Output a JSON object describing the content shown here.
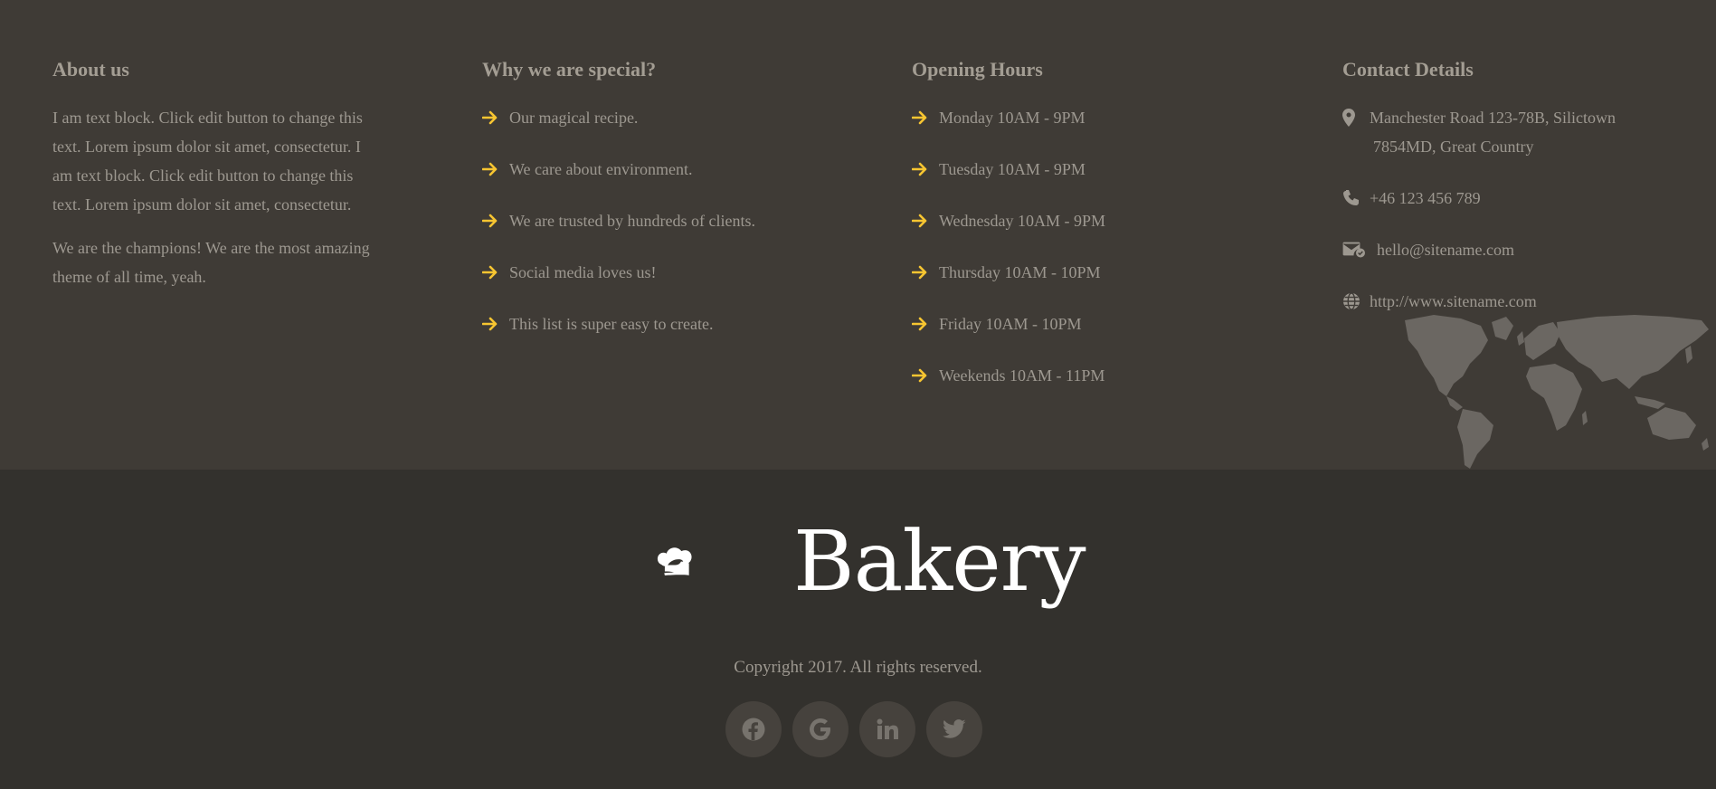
{
  "colors": {
    "accent": "#f7c531",
    "top_bg": "#3f3b36",
    "bottom_bg": "#33312d",
    "text": "#9d9890"
  },
  "about": {
    "title": "About us",
    "paragraph1": "I am text block. Click edit button to change this text. Lorem ipsum dolor sit amet, consectetur. I am text block. Click edit button to change this text. Lorem ipsum dolor sit amet, consectetur.",
    "paragraph2": "We are the champions! We are the most amazing theme of all time, yeah."
  },
  "special": {
    "title": "Why we are special?",
    "items": [
      "Our magical recipe.",
      "We care about environment.",
      "We are trusted by hundreds of clients.",
      "Social media loves us!",
      "This list is super easy to create."
    ]
  },
  "hours": {
    "title": "Opening Hours",
    "items": [
      "Monday 10AM - 9PM",
      "Tuesday 10AM - 9PM",
      "Wednesday 10AM - 9PM",
      "Thursday 10AM - 10PM",
      "Friday 10AM - 10PM",
      "Weekends 10AM - 11PM"
    ]
  },
  "contact": {
    "title": "Contact Details",
    "address_line1": "Manchester Road 123-78B, Silictown",
    "address_line2": "7854MD, Great Country",
    "phone": "+46 123 456 789",
    "email": "hello@sitename.com",
    "website": "http://www.sitename.com",
    "icons": [
      "map-pin-icon",
      "phone-icon",
      "email-icon",
      "globe-icon"
    ]
  },
  "footer": {
    "logo_text": "Bakery",
    "copyright": "Copyright 2017. All rights reserved.",
    "socials": [
      "facebook-icon",
      "google-icon",
      "linkedin-icon",
      "twitter-icon"
    ]
  }
}
